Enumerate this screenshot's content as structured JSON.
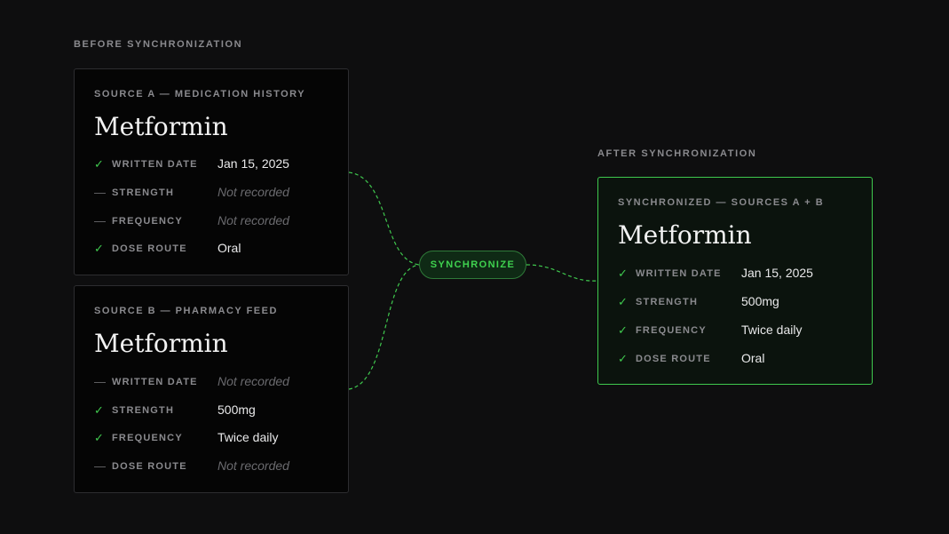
{
  "before_label": "BEFORE SYNCHRONIZATION",
  "after_label": "AFTER SYNCHRONIZATION",
  "sync_button_label": "SYNCHRONIZE",
  "colors": {
    "accent": "#3fc84e",
    "background": "#0e0e0f",
    "muted": "#8a8a8e"
  },
  "source_a": {
    "header": "SOURCE A — MEDICATION HISTORY",
    "title": "Metformin",
    "rows": [
      {
        "mark": "✓",
        "field": "WRITTEN DATE",
        "value": "Jan 15, 2025"
      },
      {
        "mark": "—",
        "field": "STRENGTH",
        "value": "Not recorded"
      },
      {
        "mark": "—",
        "field": "FREQUENCY",
        "value": "Not recorded"
      },
      {
        "mark": "✓",
        "field": "DOSE ROUTE",
        "value": "Oral"
      }
    ]
  },
  "source_b": {
    "header": "SOURCE B — PHARMACY FEED",
    "title": "Metformin",
    "rows": [
      {
        "mark": "—",
        "field": "WRITTEN DATE",
        "value": "Not recorded"
      },
      {
        "mark": "✓",
        "field": "STRENGTH",
        "value": "500mg"
      },
      {
        "mark": "✓",
        "field": "FREQUENCY",
        "value": "Twice daily"
      },
      {
        "mark": "—",
        "field": "DOSE ROUTE",
        "value": "Not recorded"
      }
    ]
  },
  "synchronized": {
    "header": "SYNCHRONIZED — SOURCES A + B",
    "title": "Metformin",
    "rows": [
      {
        "mark": "✓",
        "field": "WRITTEN DATE",
        "value": "Jan 15, 2025"
      },
      {
        "mark": "✓",
        "field": "STRENGTH",
        "value": "500mg"
      },
      {
        "mark": "✓",
        "field": "FREQUENCY",
        "value": "Twice daily"
      },
      {
        "mark": "✓",
        "field": "DOSE ROUTE",
        "value": "Oral"
      }
    ]
  }
}
